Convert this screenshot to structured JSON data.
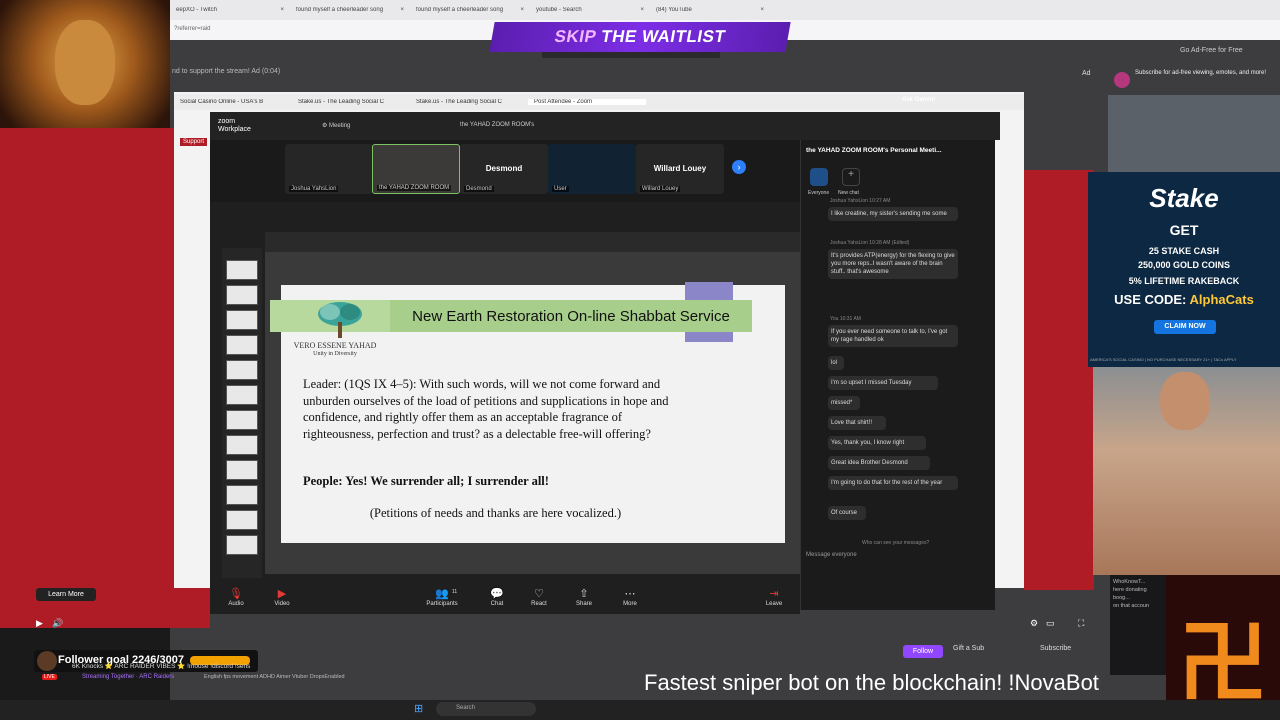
{
  "browser": {
    "tabs": [
      "eepXO - Twitch",
      "found myself a cheerleader song",
      "found myself a cheerleader song",
      "youtube - Search",
      "(84) YouTube"
    ],
    "url": "?referrer=raid",
    "ad_free": "Go Ad-Free for Free"
  },
  "overlay": {
    "skip_prefix": "SKIP",
    "skip_rest": "THE WAITLIST"
  },
  "twitch": {
    "ad_text": "nd to support the stream! Ad (0:04)",
    "ad_badge": "Ad",
    "learn_more": "Learn More",
    "promo": "Subscribe for ad-free viewing, emotes, and more!",
    "follower_goal": "Follower goal 2246/3007",
    "live": "LIVE",
    "stream_title": "6K Knocks ⭐ ARC RAIDER VIBES ⭐ !mouse !discord !sens",
    "streaming_together": "Streaming Together · ARC Raiders",
    "tags": "English   fps   movement   ADHD   Aimer   Vtuber   DropsEnabled",
    "follow": "Follow",
    "gift_sub": "Gift a Sub",
    "subscribe": "Subscribe",
    "ticker": "Fastest sniper bot on the blockchain! !NovaBot",
    "sidebar_chat": [
      "WhoKnowT...",
      "here donating",
      "boog...",
      "on that accoun"
    ]
  },
  "zoom": {
    "tabs": [
      "Social Casino Online - USA's B",
      "Stake.us - The Leading Social C",
      "Stake.us - The Leading Social C",
      "Post Attendee - Zoom"
    ],
    "ask_gemini": "Ask Gemini",
    "app_name": "zoom",
    "app_sub": "Workplace",
    "support": "Support",
    "meeting": "Meeting",
    "room_title": "the YAHAD ZOOM ROOM's",
    "participants": [
      {
        "center": "",
        "name": "Joshua YahsLion"
      },
      {
        "center": "",
        "name": "the YAHAD ZOOM ROOM"
      },
      {
        "center": "Desmond",
        "name": "Desmond"
      },
      {
        "center": "",
        "name": "User"
      },
      {
        "center": "Willard Louey",
        "name": "Willard Louey"
      }
    ],
    "bottom_buttons": [
      "Audio",
      "Video",
      "Participants",
      "Chat",
      "React",
      "Share",
      "More",
      "Leave"
    ],
    "participants_count": "11"
  },
  "slide": {
    "title": "New Earth Restoration On-line Shabbat Service",
    "org_name": "VERO ESSENE YAHAD",
    "org_tag": "Unity in Diversity",
    "body": "Leader: (1QS IX 4–5): With such words, will we not come forward and unburden ourselves of the load of petitions and supplications in hope and confidence, and rightly offer them as an acceptable fragrance of righteousness, perfection and trust? as a delectable free-will offering?",
    "people": "People: Yes! We surrender all; I surrender all!",
    "petitions": "(Petitions of needs and thanks are here vocalized.)"
  },
  "chat": {
    "header": "the YAHAD ZOOM ROOM's Personal Meeti...",
    "tab_everyone": "Everyone",
    "tab_new": "New chat",
    "messages": [
      {
        "meta": "Joshua YahsLion 10:27 AM",
        "text": "I like creatine, my sister's sending me some"
      },
      {
        "meta": "Joshua YahsLion 10:28 AM (Edited)",
        "text": "It's provides ATP(energy) for the flexing to give you more reps..I wasn't aware of the brain stuff.. that's awesome"
      },
      {
        "meta": "You 10:31 AM",
        "text": "If you ever need someone to talk to, I've got my rage handled ok"
      },
      {
        "meta": "",
        "text": "lol"
      },
      {
        "meta": "",
        "text": "I'm so upset I missed Tuesday"
      },
      {
        "meta": "",
        "text": "missed*"
      },
      {
        "meta": "",
        "text": "Love that shirt!!"
      },
      {
        "meta": "",
        "text": "Yes, thank you, I know right"
      },
      {
        "meta": "",
        "text": "Great idea Brother Desmond"
      },
      {
        "meta": "",
        "text": "I'm going to do that for the rest of the year"
      },
      {
        "meta": "",
        "text": "Of course"
      }
    ],
    "who_can_see": "Who can see your messages?",
    "input_placeholder": "Message everyone"
  },
  "stake": {
    "logo": "Stake",
    "get": "GET",
    "line1": "25 STAKE CASH",
    "line2": "250,000 GOLD COINS",
    "line3": "5% LIFETIME RAKEBACK",
    "code_label": "USE CODE:",
    "code": "AlphaCats",
    "claim": "CLAIM NOW",
    "footer": "AMERICA'S SOCIAL CASINO | NO PURCHASE NECESSARY   21+ | T&Cs APPLY"
  },
  "taskbar": {
    "search": "Search"
  },
  "colors": {
    "zoom_bg": "#1f1f1f",
    "slide_title": "#a7cf8b",
    "twitch_purple": "#9147ff",
    "stake_bg": "#0d2842"
  }
}
